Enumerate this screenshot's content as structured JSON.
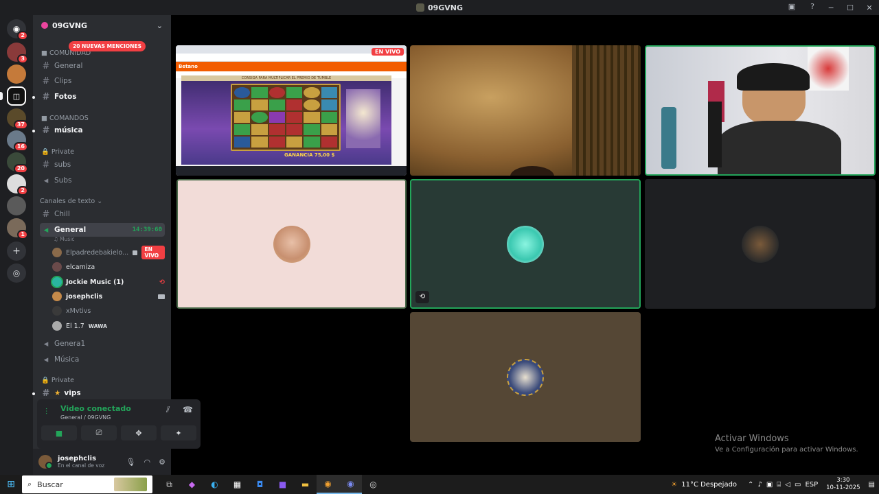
{
  "window": {
    "title": "09GVNG"
  },
  "server_badges": [
    "2",
    "3",
    "37",
    "16",
    "20",
    "2",
    "1"
  ],
  "guild": {
    "name": "09GVNG",
    "mentions_badge": "20 NUEVAS MENCIONES"
  },
  "categories": {
    "comunidad": "COMUNIDAD",
    "comandos": "COMANDOS",
    "private1": "Private",
    "canales": "Canales de texto",
    "private2": "Private"
  },
  "channels": {
    "general": "General",
    "clips": "Clips",
    "fotos": "Fotos",
    "musica": "música",
    "subs": "subs",
    "subs_voice": "Subs",
    "chill": "Chill",
    "general_voice": "General",
    "general_sub": "Music",
    "general_time": "14:39:60",
    "genera1": "Genera1",
    "musica2": "Música",
    "vips": "vips"
  },
  "voice_users": [
    {
      "name": "Elpadredebakielo...",
      "badge": "EN VIVO"
    },
    {
      "name": "elcamiza"
    },
    {
      "name": "Jockie Music (1)"
    },
    {
      "name": "josephclis"
    },
    {
      "name": "xMvtivs"
    },
    {
      "name": "El 1.7",
      "tag": "WAWA"
    }
  ],
  "voice_connection": {
    "status": "Video conectado",
    "location": "General / 09GVNG"
  },
  "user": {
    "name": "josephclis",
    "status": "En el canal de voz"
  },
  "stream": {
    "live_badge": "EN VIVO",
    "site": "Betano",
    "win_label": "GANANCIA 75,00 $",
    "promo": "CONSIGA PARA MULTIPLICAR EL PREMIO DE TUMBLE"
  },
  "watermark": {
    "title": "Activar Windows",
    "subtitle": "Ve a Configuración para activar Windows."
  },
  "taskbar": {
    "search": "Buscar",
    "weather": "11°C  Despejado",
    "lang": "ESP",
    "time": "3:30",
    "date": "10-11-2025"
  },
  "colors": {
    "speaking": "#23a55a",
    "danger": "#f23f43",
    "sidebar": "#2b2d31",
    "rail": "#1e1f22"
  }
}
